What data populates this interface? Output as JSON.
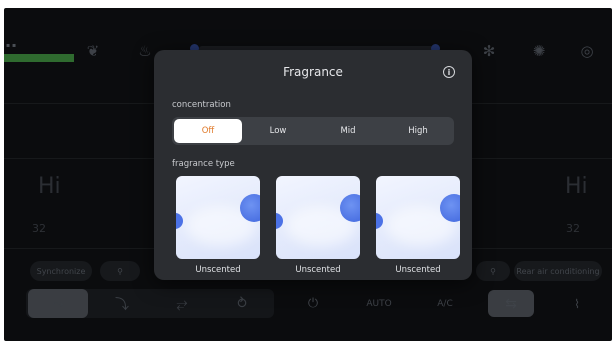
{
  "dialog": {
    "title": "Fragrance",
    "concentration_label": "concentration",
    "concentration_options": [
      "Off",
      "Low",
      "Mid",
      "High"
    ],
    "concentration_selected": "Off",
    "fragrance_type_label": "fragrance type",
    "fragrance_types": [
      {
        "label": "Unscented"
      },
      {
        "label": "Unscented"
      },
      {
        "label": "Unscented"
      }
    ]
  },
  "background": {
    "left_temp": "Hi",
    "right_temp": "Hi",
    "left_temp_value": "32",
    "right_temp_value": "32",
    "synchronize_label": "Synchronize",
    "rear_ac_label": "Rear air conditioning",
    "auto_label": "AUTO",
    "ac_label": "A/C"
  },
  "colors": {
    "screen_bg": "#0b0c0e",
    "dialog_bg": "#2b2d31",
    "selected_text": "#e07a2a",
    "card_accent": "#3d63dc"
  }
}
